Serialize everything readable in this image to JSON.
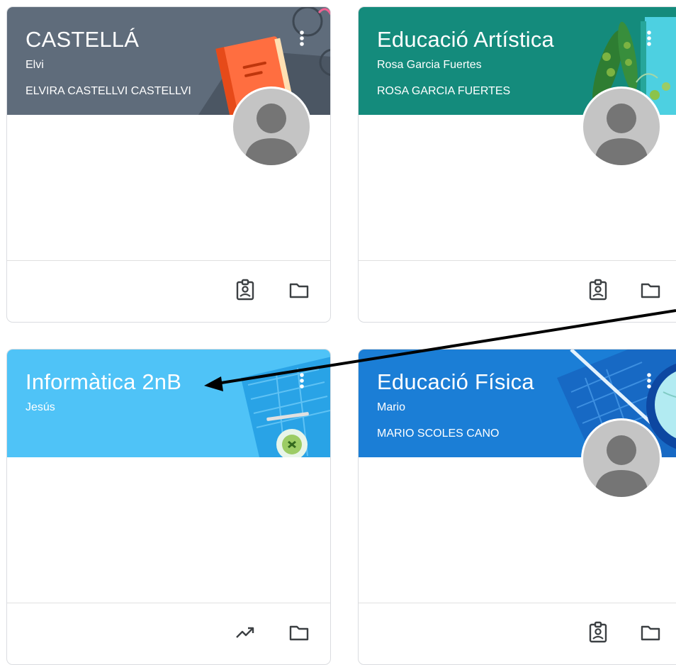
{
  "colors": {
    "castella_banner": "#5f6c7b",
    "artistica_banner": "#148b7c",
    "informatica_banner": "#4fc3f7",
    "fisica_banner": "#1b7ed6",
    "icon_gray": "#5f6368"
  },
  "cards": [
    {
      "title": "CASTELLÁ",
      "subtitle": "Elvi",
      "teacher": "ELVIRA CASTELLVI CASTELLVI",
      "footer_icons": [
        "assignment-ind-icon",
        "folder-icon"
      ]
    },
    {
      "title": "Educació Artística",
      "subtitle": "Rosa Garcia Fuertes",
      "teacher": "ROSA GARCIA FUERTES",
      "footer_icons": [
        "assignment-ind-icon",
        "folder-icon"
      ]
    },
    {
      "title": "Informàtica 2nB",
      "subtitle": "Jesús",
      "teacher": "",
      "footer_icons": [
        "trending-up-icon",
        "folder-icon"
      ]
    },
    {
      "title": "Educació Física",
      "subtitle": "Mario",
      "teacher": "MARIO SCOLES CANO",
      "footer_icons": [
        "assignment-ind-icon",
        "folder-icon"
      ]
    }
  ]
}
